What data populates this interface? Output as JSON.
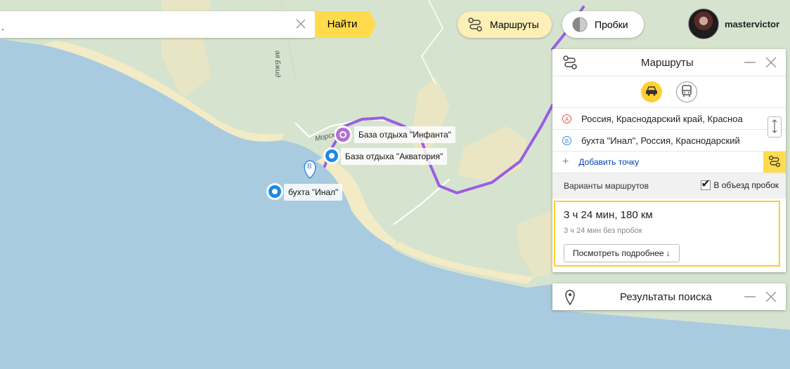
{
  "search": {
    "value": ".",
    "button_label": "Найти"
  },
  "header": {
    "routes_label": "Маршруты",
    "traffic_label": "Пробки",
    "username": "mastervictor"
  },
  "routes_panel": {
    "title": "Маршруты",
    "waypoints": [
      {
        "badge": "A",
        "text": "Россия, Краснодарский край, Красноа"
      },
      {
        "badge": "B",
        "text": "бухта \"Инал\", Россия, Краснодарский"
      }
    ],
    "add_point_label": "Добавить точку",
    "variants_label": "Варианты маршрутов",
    "avoid_traffic_label": "В объезд пробок",
    "avoid_traffic_checked": true,
    "route": {
      "time_distance": "3 ч 24 мин, 180 км",
      "without_traffic": "3 ч 24 мин без пробок",
      "details_label": "Посмотреть подробнее ↓"
    }
  },
  "search_results_panel": {
    "title": "Результаты поиска"
  },
  "map": {
    "labels": [
      {
        "text": "База отдыха \"Инфанта\""
      },
      {
        "text": "База отдыха \"Акватория\""
      },
      {
        "text": "бухта \"Инал\""
      }
    ],
    "pin_b_letter": "B",
    "street_text_1": "Морск",
    "street_text_2": "ая Бжид",
    "colors": {
      "sea": "#a9cbe0",
      "land": "#d6e4cf",
      "beach": "#f3ebc6",
      "route": "#9b5de5",
      "accent": "#ffdb4d"
    }
  }
}
